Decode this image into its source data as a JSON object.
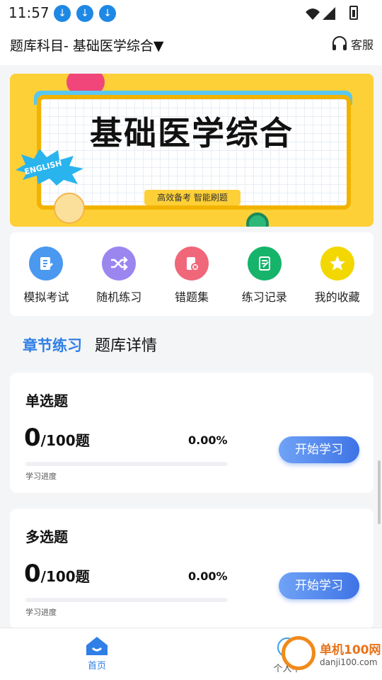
{
  "status_bar": {
    "time": "11:57"
  },
  "header": {
    "subject_label": "题库科目- 基础医学综合▼",
    "service_label": "客服"
  },
  "banner": {
    "title": "基础医学综合",
    "tagline": "高效备考  智能刷题",
    "badge": "ENGLISH"
  },
  "quick_actions": [
    {
      "label": "模拟考试",
      "icon": "exam-icon",
      "color": "#4a98f0"
    },
    {
      "label": "随机练习",
      "icon": "shuffle-icon",
      "color": "#9b86f0"
    },
    {
      "label": "错题集",
      "icon": "wrong-questions-icon",
      "color": "#f0677a"
    },
    {
      "label": "练习记录",
      "icon": "record-icon",
      "color": "#16b36b"
    },
    {
      "label": "我的收藏",
      "icon": "star-icon",
      "color": "#f2d800"
    }
  ],
  "tabs": {
    "chapter": "章节练习",
    "bank_detail": "题库详情"
  },
  "cards": [
    {
      "title": "单选题",
      "done": "0",
      "total": "/100题",
      "percent": "0.00%",
      "progress": 0,
      "progress_label": "学习进度",
      "button": "开始学习"
    },
    {
      "title": "多选题",
      "done": "0",
      "total": "/100题",
      "percent": "0.00%",
      "progress": 0,
      "progress_label": "学习进度",
      "button": "开始学习"
    }
  ],
  "bottom_nav": {
    "home": "首页",
    "me": "个人中"
  },
  "watermark": {
    "name": "单机100网",
    "url": "danji100.com"
  },
  "colors": {
    "accent": "#2f7fe6",
    "banner": "#fdd038"
  }
}
